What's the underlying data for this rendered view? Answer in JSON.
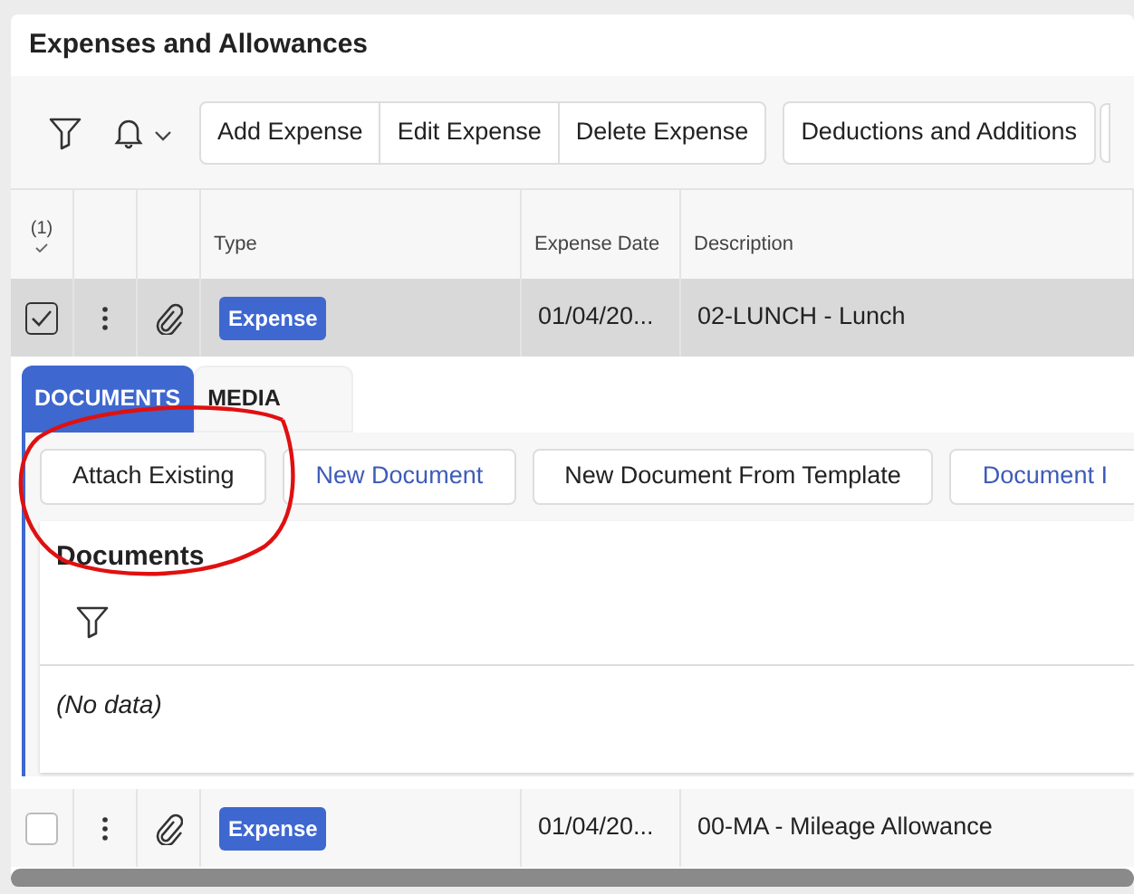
{
  "panel": {
    "title": "Expenses and Allowances"
  },
  "toolbar": {
    "button_groups": [
      [
        "Add Expense",
        "Edit Expense",
        "Delete Expense"
      ],
      [
        "Deductions and Additions"
      ]
    ]
  },
  "table": {
    "selection_count": "(1)",
    "columns": [
      "Type",
      "Expense Date",
      "Description"
    ],
    "rows": [
      {
        "selected": true,
        "expanded": true,
        "type": "Expense",
        "date": "01/04/20...",
        "description": "02-LUNCH - Lunch"
      },
      {
        "selected": false,
        "expanded": false,
        "type": "Expense",
        "date": "01/04/20...",
        "description": "00-MA - Mileage Allowance"
      }
    ]
  },
  "detail": {
    "tabs": [
      {
        "label": "DOCUMENTS",
        "selected": true
      },
      {
        "label": "MEDIA",
        "selected": false
      }
    ],
    "actions": [
      {
        "label": "Attach Existing",
        "kind": "plain"
      },
      {
        "label": "New Document",
        "kind": "link"
      },
      {
        "label": "New Document From Template",
        "kind": "plain"
      },
      {
        "label": "Document I",
        "kind": "link"
      }
    ],
    "documents": {
      "title": "Documents",
      "empty_text": "(No data)"
    }
  },
  "annotation": {
    "kind": "ellipse"
  }
}
